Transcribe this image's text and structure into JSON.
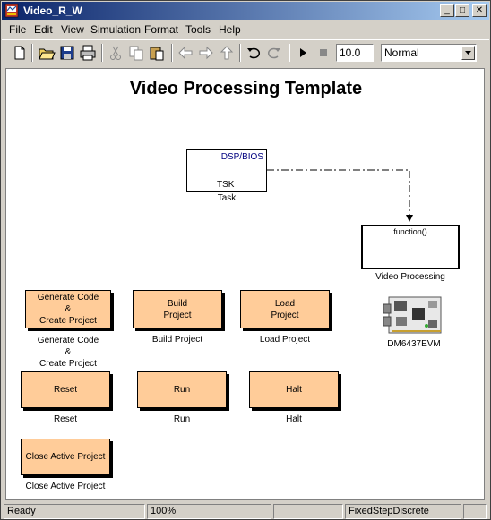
{
  "window": {
    "title": "Video_R_W"
  },
  "title_buttons": {
    "minimize": "_",
    "maximize": "□",
    "close": "✕"
  },
  "menu": [
    "File",
    "Edit",
    "View",
    "Simulation",
    "Format",
    "Tools",
    "Help"
  ],
  "toolbar": {
    "stop_time": "10.0",
    "sim_mode": "Normal"
  },
  "canvas": {
    "title": "Video Processing Template",
    "task_block": {
      "top_text": "DSP/BIOS",
      "inner_text": "TSK",
      "label": "Task"
    },
    "function_block": {
      "inner_text": "function()",
      "label": "Video Processing"
    },
    "board": {
      "label": "DM6437EVM"
    },
    "buttons": [
      {
        "text": "Generate Code\n&\nCreate Project",
        "label": "Generate Code\n&\nCreate Project"
      },
      {
        "text": "Build\nProject",
        "label": "Build Project"
      },
      {
        "text": "Load\nProject",
        "label": "Load Project"
      },
      {
        "text": "Reset",
        "label": "Reset"
      },
      {
        "text": "Run",
        "label": "Run"
      },
      {
        "text": "Halt",
        "label": "Halt"
      },
      {
        "text": "Close Active Project",
        "label": "Close Active Project"
      }
    ]
  },
  "status": {
    "ready": "Ready",
    "zoom": "100%",
    "solver": "FixedStepDiscrete"
  },
  "colors": {
    "titlebar": "#0a246a",
    "block_fill": "#ffcc99",
    "dsp_text": "#000080"
  }
}
